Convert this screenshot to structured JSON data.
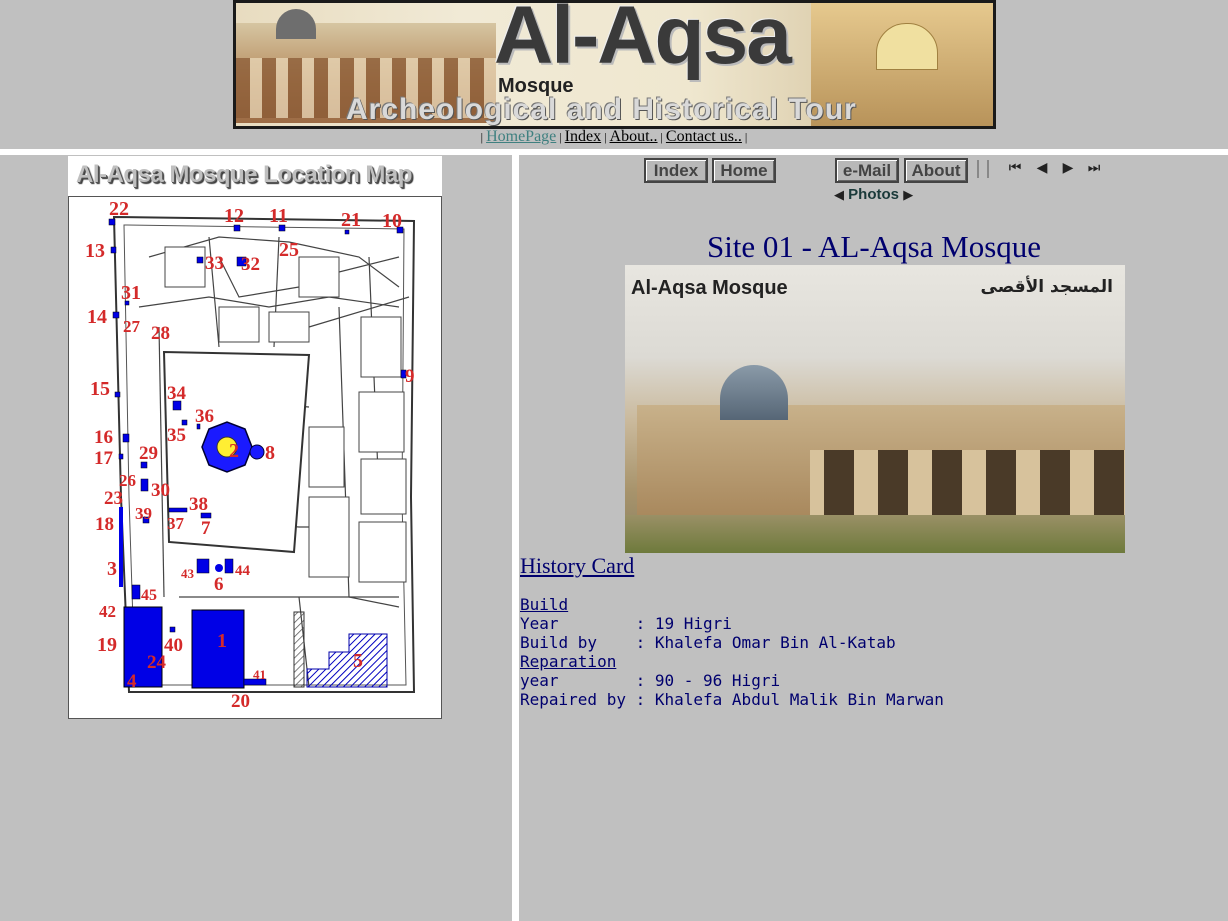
{
  "banner": {
    "title": "Al-Aqsa",
    "subtitle_small": "Mosque",
    "subtitle": "Archeological and Historical Tour"
  },
  "topnav": {
    "items": [
      "HomePage",
      "Index",
      "About..",
      "Contact us.."
    ],
    "separator": "|"
  },
  "left": {
    "map_title": "Al-Aqsa Mosque Location Map",
    "map_numbers": [
      "1",
      "2",
      "3",
      "4",
      "5",
      "6",
      "7",
      "8",
      "9",
      "10",
      "11",
      "12",
      "13",
      "14",
      "15",
      "16",
      "17",
      "18",
      "19",
      "20",
      "21",
      "22",
      "23",
      "24",
      "25",
      "26",
      "27",
      "28",
      "29",
      "30",
      "31",
      "32",
      "33",
      "34",
      "35",
      "36",
      "37",
      "38",
      "39",
      "40",
      "41",
      "42",
      "43",
      "44",
      "45"
    ]
  },
  "right": {
    "buttons": {
      "index": "Index",
      "home": "Home",
      "email": "e-Mail",
      "about": "About"
    },
    "nav_icons": [
      "first-icon",
      "prev-icon",
      "next-icon",
      "last-icon"
    ],
    "photos_label": "Photos",
    "site_title": "Site 01 - AL-Aqsa Mosque",
    "photo_caption_en": "Al-Aqsa Mosque",
    "photo_caption_ar": "المسجد الأقصى",
    "history_link": "History Card",
    "history": {
      "build_heading": "Build",
      "year_label": "Year        ",
      "year_value": ": 19 Higri",
      "buildby_label": "Build by    ",
      "buildby_value": ": Khalefa Omar Bin Al-Katab",
      "reparation_heading": "Reparation",
      "ryear_label": "year        ",
      "ryear_value": ": 90 - 96 Higri",
      "repairedby_label": "Repaired by ",
      "repairedby_value": ": Khalefa Abdul Malik Bin Marwan"
    }
  },
  "colors": {
    "background": "#c0c0c0",
    "title_blue": "#00006e",
    "map_red": "#d33",
    "map_blue": "#0000e0"
  }
}
